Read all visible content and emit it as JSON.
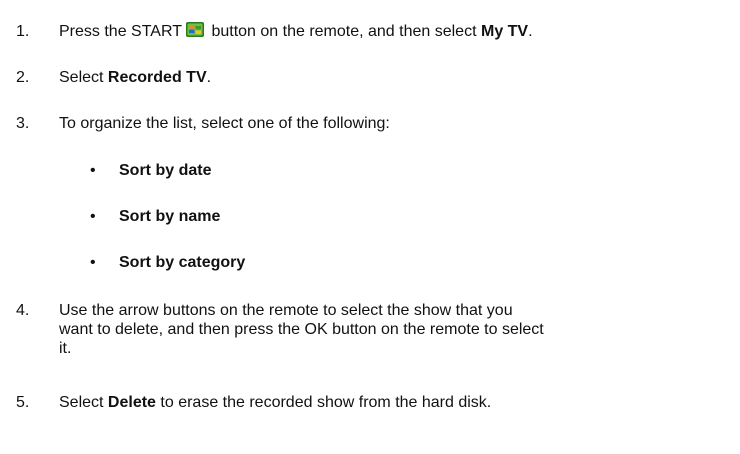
{
  "steps": [
    {
      "num": "1.",
      "pre": "Press the START",
      "mid": "button on the remote, and then select",
      "bold": "My TV",
      "post": "."
    },
    {
      "num": "2.",
      "pre": "Select",
      "bold": "Recorded TV",
      "post": "."
    },
    {
      "num": "3.",
      "text": "To organize the list, select one of the following:"
    },
    {
      "num": "4.",
      "line1": "Use the arrow buttons on the remote to select the show that you",
      "line2": "want to delete, and then press the OK button on the remote to select",
      "line3": "it."
    },
    {
      "num": "5.",
      "pre": "Select",
      "bold": "Delete",
      "post": "to erase the recorded show from the hard disk."
    }
  ],
  "bullets": [
    {
      "symbol": "•",
      "text": "Sort by date"
    },
    {
      "symbol": "•",
      "text": "Sort by name"
    },
    {
      "symbol": "•",
      "text": "Sort by category"
    }
  ],
  "icons": {
    "start_logo": "windows-start-logo-icon"
  },
  "colors": {
    "text": "#111111",
    "logo_green": "#3a9a2a",
    "logo_orange": "#e8882a",
    "logo_blue": "#2a6ac8",
    "logo_yellow": "#e8c82a"
  }
}
